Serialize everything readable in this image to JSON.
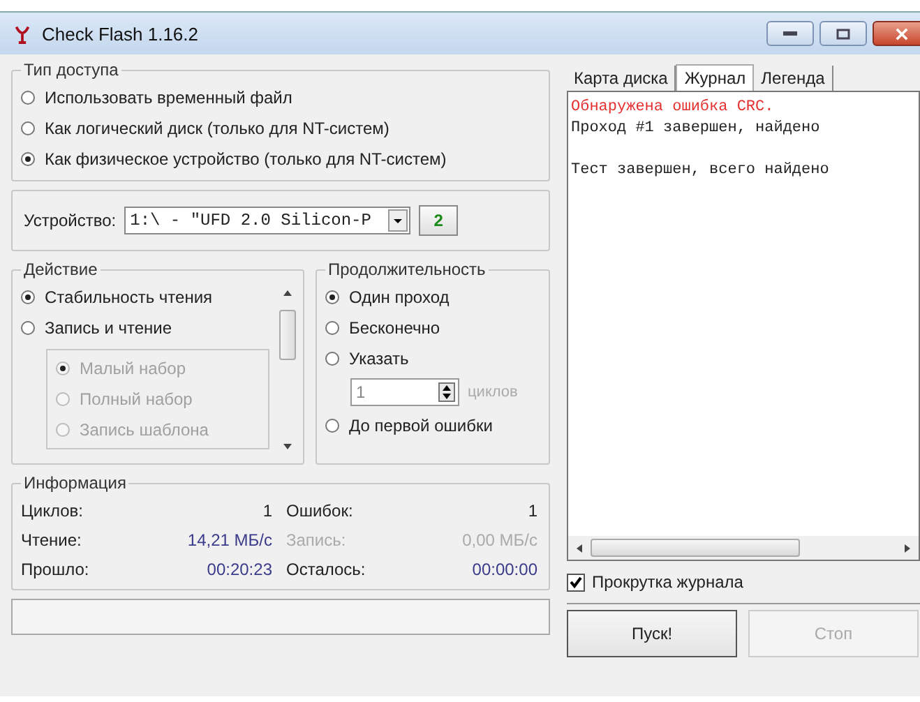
{
  "window": {
    "title": "Check Flash 1.16.2"
  },
  "access": {
    "title": "Тип доступа",
    "options": [
      {
        "label": "Использовать временный файл",
        "selected": false
      },
      {
        "label": "Как логический диск (только для NT-систем)",
        "selected": false
      },
      {
        "label": "Как физическое устройство (только для NT-систем)",
        "selected": true
      }
    ]
  },
  "device": {
    "label": "Устройство:",
    "value": "1:\\ - \"UFD 2.0 Silicon-P",
    "refresh_button": "2"
  },
  "action": {
    "title": "Действие",
    "options": [
      {
        "label": "Стабильность чтения",
        "selected": true
      },
      {
        "label": "Запись и чтение",
        "selected": false,
        "children": [
          {
            "label": "Малый набор",
            "selected": true,
            "disabled": true
          },
          {
            "label": "Полный набор",
            "selected": false,
            "disabled": true
          },
          {
            "label": "Запись шаблона",
            "selected": false,
            "disabled": true
          }
        ]
      }
    ]
  },
  "duration": {
    "title": "Продолжительность",
    "items": [
      {
        "kind": "radio",
        "label": "Один проход",
        "selected": true
      },
      {
        "kind": "radio",
        "label": "Бесконечно",
        "selected": false
      },
      {
        "kind": "radio",
        "label": "Указать",
        "selected": false
      },
      {
        "kind": "spin",
        "value": "1",
        "unit": "циклов",
        "disabled": true
      },
      {
        "kind": "radio",
        "label": "До первой ошибки",
        "selected": false
      }
    ]
  },
  "info": {
    "title": "Информация",
    "items": [
      {
        "label": "Циклов:",
        "value": "1",
        "disabled": false,
        "kind": "count"
      },
      {
        "label": "Ошибок:",
        "value": "1",
        "disabled": false,
        "kind": "count"
      },
      {
        "label": "Чтение:",
        "value": "14,21 МБ/с",
        "disabled": false,
        "kind": "measure"
      },
      {
        "label": "Запись:",
        "value": "0,00 МБ/с",
        "disabled": true,
        "kind": "measure"
      },
      {
        "label": "Прошло:",
        "value": "00:20:23",
        "disabled": false,
        "kind": "measure"
      },
      {
        "label": "Осталось:",
        "value": "00:00:00",
        "disabled": false,
        "kind": "measure"
      }
    ]
  },
  "progress": {
    "level": 0
  },
  "tabs": [
    {
      "label": "Карта диска",
      "selected": false
    },
    {
      "label": "Журнал",
      "selected": true
    },
    {
      "label": "Легенда",
      "selected": false
    }
  ],
  "log": [
    {
      "kind": "error",
      "text": "Обнаружена ошибка CRC."
    },
    {
      "kind": "normal",
      "text": "Проход #1 завершен, найдено"
    },
    {
      "kind": "blank"
    },
    {
      "kind": "normal",
      "text": "Тест завершен, всего найдено"
    }
  ],
  "autoscroll": {
    "label": "Прокрутка журнала",
    "checked": true
  },
  "buttons": [
    {
      "label": "Пуск!",
      "disabled": false
    },
    {
      "label": "Стоп",
      "disabled": true
    }
  ]
}
